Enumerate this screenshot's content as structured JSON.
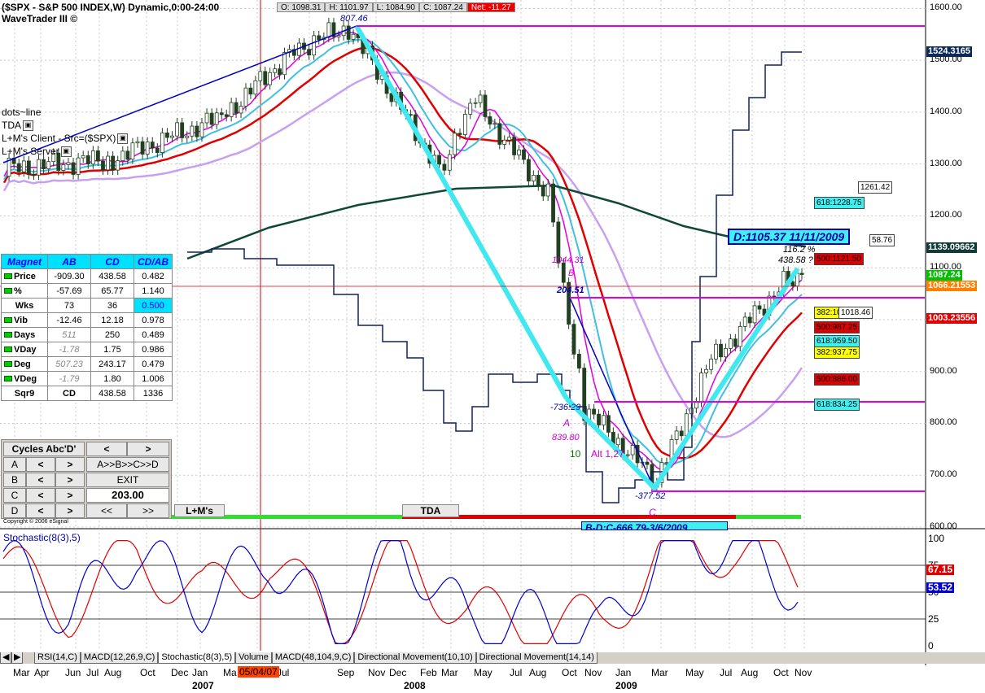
{
  "header": {
    "title": "($SPX - S&P 500 INDEX,W) Dynamic,0:00-24:00",
    "subtitle": "WaveTrader III ©",
    "open": "O: 1098.31",
    "high": "H: 1101.97",
    "low": "L: 1084.90",
    "close": "C: 1087.24",
    "net": "Net: -11.27"
  },
  "studies": [
    "dots~line",
    "TDA",
    "L+M's Client - Src=($SPX)",
    "L+M's Server"
  ],
  "magnet": {
    "headers": [
      "Magnet",
      "AB",
      "CD",
      "CD/AB"
    ],
    "rows": [
      {
        "label": "Price",
        "ab": "-909.30",
        "cd": "438.58",
        "ratio": "0.482"
      },
      {
        "label": "%",
        "ab": "-57.69",
        "cd": "65.77",
        "ratio": "1.140"
      },
      {
        "label": "Wks",
        "ab": "73",
        "cd": "36",
        "ratio": "0.500"
      },
      {
        "label": "Vib",
        "ab": "-12.46",
        "cd": "12.18",
        "ratio": "0.978"
      },
      {
        "label": "Days",
        "ab": "511",
        "cd": "250",
        "ratio": "0.489"
      },
      {
        "label": "VDay",
        "ab": "-1.78",
        "cd": "1.75",
        "ratio": "0.986"
      },
      {
        "label": "Deg",
        "ab": "507.23",
        "cd": "243.17",
        "ratio": "0.479"
      },
      {
        "label": "VDeg",
        "ab": "-1.79",
        "cd": "1.80",
        "ratio": "1.006"
      },
      {
        "label": "Sqr9",
        "ab": "CD",
        "cd": "438.58",
        "ratio": "1336"
      }
    ]
  },
  "cycles": {
    "title": "Cycles Abc'D'",
    "rows": [
      "A",
      "B",
      "C",
      "D"
    ],
    "seq": "A>>B>>C>>D",
    "exit": "EXIT",
    "value": "203.00",
    "prev": "<<",
    "next": ">>",
    "left_arrow": "<",
    "right_arrow": ">"
  },
  "labels": {
    "lm": "L+M's",
    "tda": "TDA",
    "copyright": "Copyright © 2006 eSignal",
    "stoch_title": "Stochastic(8(3),5)",
    "d_target": "D:1105.37 11/11/2009",
    "bottom_partial": "B-D:C-666.79-3/6/2009",
    "alt": "Alt 1,27",
    "ten": "10"
  },
  "annotations": {
    "top": "807.46",
    "b_val": "1044.31",
    "b": "B",
    "ab_move": "204.51",
    "a_move": "-736.29",
    "a": "A",
    "a_val": "839.80",
    "c_move": "-377.52",
    "c": "C",
    "pct": "116.2 %",
    "cd_val": "438.58 ?"
  },
  "price_axis": {
    "ticks": [
      "1600.00",
      "1500.00",
      "1400.00",
      "1300.00",
      "1200.00",
      "1100.00",
      "1000.00",
      "900.00",
      "800.00",
      "700.00",
      "600.00"
    ],
    "ylim": [
      600,
      1610
    ],
    "boxes": [
      {
        "text": "1524.3165",
        "bg": "#0b2a5a",
        "fg": "#ffffff"
      },
      {
        "text": "1139.09662",
        "bg": "#103a38",
        "fg": "#ffffff"
      },
      {
        "text": "1087.24",
        "bg": "#00c000",
        "fg": "#ffffff"
      },
      {
        "text": "1066.21553",
        "bg": "#ff8000",
        "fg": "#ffffff"
      },
      {
        "text": "1003.23556",
        "bg": "#e00000",
        "fg": "#ffffff"
      }
    ],
    "level_labels": [
      {
        "text": "1261.42",
        "bg": "#ffffff",
        "fg": "#000000"
      },
      {
        "text": "618:1228.75",
        "bg": "#40f0f0",
        "fg": "#000000"
      },
      {
        "text": "58.76",
        "bg": "#ffffff",
        "fg": "#000000"
      },
      {
        "text": "500:1121.50",
        "bg": "#e00000",
        "fg": "#000000"
      },
      {
        "text": "382:1015.25",
        "bg": "#ffff00",
        "fg": "#000000"
      },
      {
        "text": "1018.46",
        "bg": "#ffffff",
        "fg": "#000000"
      },
      {
        "text": "500:987.25",
        "bg": "#e00000",
        "fg": "#000000"
      },
      {
        "text": "618:959.50",
        "bg": "#40f0f0",
        "fg": "#000000"
      },
      {
        "text": "382:937.75",
        "bg": "#ffff00",
        "fg": "#000000"
      },
      {
        "text": "500:886.00",
        "bg": "#e00000",
        "fg": "#000000"
      },
      {
        "text": "618:834.25",
        "bg": "#40f0f0",
        "fg": "#000000"
      }
    ]
  },
  "stoch_axis": {
    "ticks": [
      "100",
      "75",
      "50",
      "25",
      "0"
    ],
    "k_value": "67.15",
    "d_value": "53.52",
    "k_color": "#e00000",
    "d_color": "#0000d0"
  },
  "x_axis": {
    "months": [
      {
        "label": "Mar"
      },
      {
        "label": "Apr"
      },
      {
        "label": "Jun"
      },
      {
        "label": "Jul"
      },
      {
        "label": "Aug"
      },
      {
        "label": "Oct"
      },
      {
        "label": "Dec"
      },
      {
        "label": "Jan"
      },
      {
        "label": "Ma"
      },
      {
        "label": "Jun"
      },
      {
        "label": "Jul"
      },
      {
        "label": "Sep"
      },
      {
        "label": "Nov"
      },
      {
        "label": "Dec"
      },
      {
        "label": "Feb"
      },
      {
        "label": "Mar"
      },
      {
        "label": "May"
      },
      {
        "label": "Jul"
      },
      {
        "label": "Aug"
      },
      {
        "label": "Oct"
      },
      {
        "label": "Nov"
      },
      {
        "label": "Jan"
      },
      {
        "label": "Mar"
      },
      {
        "label": "May"
      },
      {
        "label": "Jul"
      },
      {
        "label": "Aug"
      },
      {
        "label": "Oct"
      },
      {
        "label": "Nov"
      }
    ],
    "cursor_date": "05/04/07",
    "years": [
      "2007",
      "2008",
      "2009"
    ]
  },
  "tabs": [
    "RSI(14,C)",
    "MACD(12,26,9,C)",
    "Stochastic(8(3),5)",
    "Volume",
    "MACD(48,104,9,C)",
    "Directional Movement(10,10)",
    "Directional Movement(14,14)"
  ],
  "chart_data": [
    {
      "type": "line",
      "title": "($SPX - S&P 500 INDEX,W) Dynamic,0:00-24:00",
      "ylim": [
        600,
        1610
      ],
      "x": [
        "2006-03",
        "2006-09",
        "2007-03",
        "2007-07",
        "2007-10",
        "2008-03",
        "2008-05",
        "2008-09",
        "2008-11",
        "2009-03",
        "2009-06",
        "2009-10",
        "2009-11"
      ],
      "series": [
        {
          "values": [
            1290,
            1310,
            1390,
            1520,
            1565,
            1290,
            1420,
            1240,
            830,
            690,
            920,
            1070,
            1087
          ]
        }
      ],
      "annotations": [
        "807.46",
        "1044.31",
        "204.51",
        "-736.29",
        "839.80",
        "-377.52",
        "116.2 %",
        "438.58 ?",
        "D:1105.37 11/11/2009"
      ]
    },
    {
      "type": "line",
      "title": "Stochastic(8(3),5)",
      "ylim": [
        0,
        100
      ],
      "x": [
        "2006-03",
        "2006-09",
        "2007-03",
        "2007-07",
        "2007-10",
        "2008-03",
        "2008-05",
        "2008-09",
        "2008-11",
        "2009-03",
        "2009-06",
        "2009-10",
        "2009-11"
      ],
      "series": [
        {
          "name": "%K",
          "values": [
            80,
            30,
            90,
            40,
            85,
            15,
            95,
            20,
            25,
            10,
            95,
            95,
            53.52
          ]
        },
        {
          "name": "%D",
          "values": [
            75,
            35,
            85,
            45,
            80,
            20,
            85,
            30,
            20,
            20,
            90,
            92,
            67.15
          ]
        }
      ]
    }
  ]
}
